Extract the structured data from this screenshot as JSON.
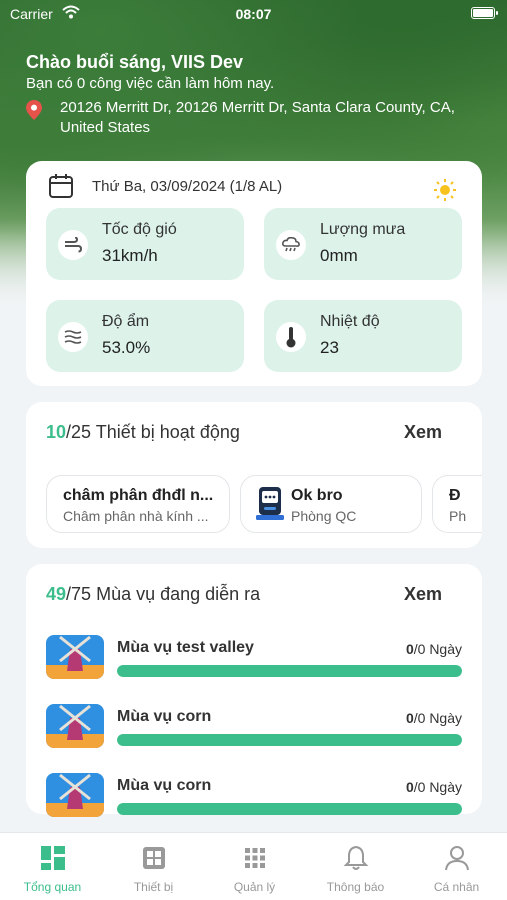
{
  "status_bar": {
    "carrier": "Carrier",
    "time": "08:07"
  },
  "header": {
    "greeting": "Chào buổi sáng, VIIS Dev",
    "subtitle": "Bạn có 0 công việc cần làm hôm nay.",
    "address": "20126 Merritt Dr, 20126 Merritt Dr, Santa Clara County, CA, United States"
  },
  "weather": {
    "date": "Thứ Ba, 03/09/2024 (1/8 AL)",
    "tiles": [
      {
        "label": "Tốc độ gió",
        "value": "31km/h",
        "icon": "wind-icon"
      },
      {
        "label": "Lượng mưa",
        "value": "0mm",
        "icon": "rain-cloud-icon"
      },
      {
        "label": "Độ ẩm",
        "value": "53.0%",
        "icon": "humidity-icon"
      },
      {
        "label": "Nhiệt độ",
        "value": "23",
        "icon": "thermometer-icon"
      }
    ]
  },
  "devices": {
    "active": "10",
    "total": "/25",
    "title": "Thiết bị hoạt động",
    "view_label": "Xem",
    "items": [
      {
        "name": "châm phân đhđl n...",
        "location": "Châm phân nhà kính ..."
      },
      {
        "name": "Ok bro",
        "location": "Phòng QC"
      },
      {
        "name": "Đ",
        "location": "Ph"
      }
    ]
  },
  "seasons": {
    "active": "49",
    "total": "/75",
    "title": "Mùa vụ đang diễn ra",
    "view_label": "Xem",
    "items": [
      {
        "name": "Mùa vụ test valley",
        "done": "0",
        "rest": "/0 Ngày",
        "progress": 1.0
      },
      {
        "name": "Mùa vụ corn",
        "done": "0",
        "rest": "/0 Ngày",
        "progress": 1.0
      },
      {
        "name": "Mùa vụ corn",
        "done": "0",
        "rest": "/0 Ngày",
        "progress": 1.0
      }
    ]
  },
  "tabbar": {
    "tabs": [
      {
        "label": "Tổng quan",
        "icon": "dashboard-icon",
        "active": true
      },
      {
        "label": "Thiết bị",
        "icon": "device-grid-icon",
        "active": false
      },
      {
        "label": "Quản lý",
        "icon": "apps-grid-icon",
        "active": false
      },
      {
        "label": "Thông báo",
        "icon": "bell-icon",
        "active": false
      },
      {
        "label": "Cá nhân",
        "icon": "user-icon",
        "active": false
      }
    ]
  },
  "colors": {
    "accent": "#3cbe8c",
    "tile_bg": "#ddf3ea"
  }
}
